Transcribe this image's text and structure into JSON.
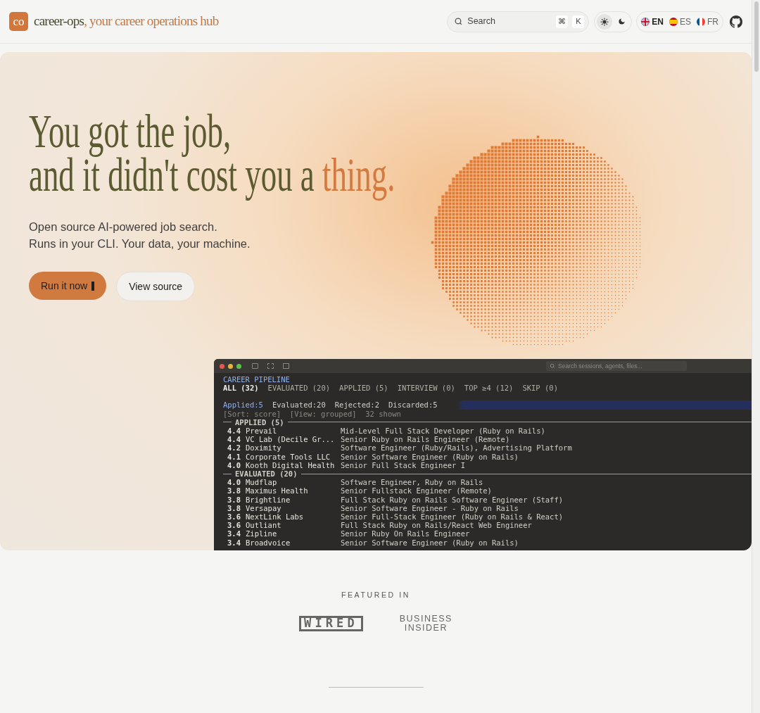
{
  "header": {
    "logo_mark": "co",
    "brand": "career-ops",
    "tagline": ", your career operations hub",
    "search": {
      "placeholder": "Search",
      "shortcut": [
        "⌘",
        "K"
      ]
    },
    "theme": [
      {
        "kind": "light",
        "selected": true
      },
      {
        "kind": "dark",
        "selected": false
      }
    ],
    "languages": [
      {
        "code": "EN",
        "kind": "uk",
        "selected": true
      },
      {
        "code": "ES",
        "kind": "es",
        "selected": false
      },
      {
        "code": "FR",
        "kind": "fr",
        "selected": false
      }
    ]
  },
  "hero": {
    "headline": [
      [
        {
          "text": "You got the job,",
          "accent": false
        }
      ],
      [
        {
          "text": "and it didn't cost you a ",
          "accent": false
        },
        {
          "text": "thing.",
          "accent": true
        }
      ]
    ],
    "subtitle": [
      "Open source AI-powered job search.",
      "Runs in your CLI. Your data, your machine."
    ],
    "buttons": [
      {
        "label": "Run it now",
        "kind": "primary"
      },
      {
        "label": "View source",
        "kind": "secondary"
      }
    ]
  },
  "terminal": {
    "search_placeholder": "Search sessions, agents, files...",
    "title": "CAREER PIPELINE",
    "filters": [
      {
        "label": "ALL (32)",
        "selected": true
      },
      {
        "label": "EVALUATED (20)",
        "selected": false
      },
      {
        "label": "APPLIED (5)",
        "selected": false
      },
      {
        "label": "INTERVIEW (0)",
        "selected": false
      },
      {
        "label": "TOP ≥4 (12)",
        "selected": false
      },
      {
        "label": "SKIP (0)",
        "selected": false
      }
    ],
    "stats": [
      {
        "text": "Applied:5",
        "selected": true
      },
      {
        "text": "Evaluated:20",
        "selected": false
      },
      {
        "text": "Rejected:2",
        "selected": false
      },
      {
        "text": "Discarded:5",
        "selected": false
      }
    ],
    "sort_line": "[Sort: score]  [View: grouped]  32 shown",
    "groups": [
      {
        "title": "APPLIED (5)",
        "rows": [
          {
            "score": "4.4",
            "company": "Prevail",
            "role": "Mid-Level Full Stack Developer (Ruby on Rails)"
          },
          {
            "score": "4.4",
            "company": "VC Lab (Decile Gr...",
            "role": "Senior Ruby on Rails Engineer (Remote)"
          },
          {
            "score": "4.2",
            "company": "Doximity",
            "role": "Software Engineer (Ruby/Rails), Advertising Platform"
          },
          {
            "score": "4.1",
            "company": "Corporate Tools LLC",
            "role": "Senior Software Engineer (Ruby on Rails)"
          },
          {
            "score": "4.0",
            "company": "Kooth Digital Health",
            "role": "Senior Full Stack Engineer I"
          }
        ]
      },
      {
        "title": "EVALUATED (20)",
        "rows": [
          {
            "score": "4.0",
            "company": "Mudflap",
            "role": "Software Engineer, Ruby on Rails"
          },
          {
            "score": "3.8",
            "company": "Maximus Health",
            "role": "Senior Fullstack Engineer (Remote)"
          },
          {
            "score": "3.8",
            "company": "Brightline",
            "role": "Full Stack Ruby on Rails Software Engineer (Staff)"
          },
          {
            "score": "3.8",
            "company": "Versapay",
            "role": "Senior Software Engineer - Ruby on Rails"
          },
          {
            "score": "3.6",
            "company": "NextLink Labs",
            "role": "Senior Full-Stack Engineer (Ruby on Rails & React)"
          },
          {
            "score": "3.6",
            "company": "Outliant",
            "role": "Full Stack Ruby on Rails/React Web Engineer"
          },
          {
            "score": "3.4",
            "company": "Zipline",
            "role": "Senior Ruby On Rails Engineer"
          },
          {
            "score": "3.4",
            "company": "Broadvoice",
            "role": "Senior Software Engineer (Ruby on Rails)"
          }
        ]
      }
    ]
  },
  "featured": {
    "heading": "FEATURED IN",
    "logos": [
      {
        "kind": "wired",
        "text": "WIRED"
      },
      {
        "kind": "stacked",
        "lines": [
          "BUSINESS",
          "INSIDER"
        ]
      }
    ]
  }
}
